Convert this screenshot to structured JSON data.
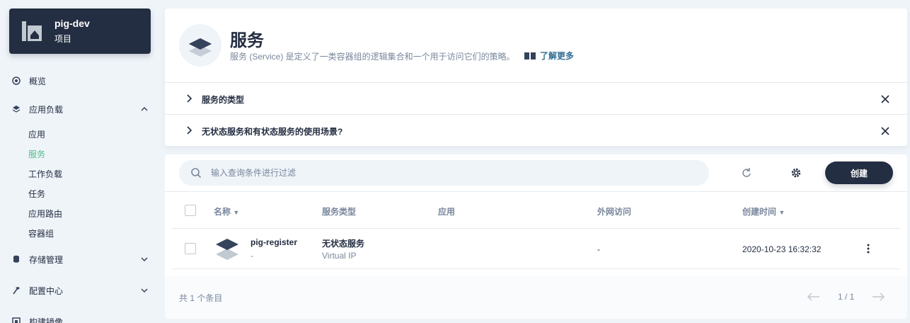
{
  "project": {
    "name": "pig-dev",
    "type": "项目"
  },
  "nav": {
    "overview": "概览",
    "workloads": "应用负载",
    "sub": [
      "应用",
      "服务",
      "工作负载",
      "任务",
      "应用路由",
      "容器组"
    ],
    "storage": "存储管理",
    "config": "配置中心",
    "build": "构建镜像"
  },
  "header": {
    "title": "服务",
    "description": "服务 (Service) 是定义了一类容器组的逻辑集合和一个用于访问它们的策略。",
    "learn_more": "了解更多",
    "collapse_1": "服务的类型",
    "collapse_2": "无状态服务和有状态服务的使用场景?"
  },
  "toolbar": {
    "search_placeholder": "输入查询条件进行过滤",
    "create_label": "创建"
  },
  "table": {
    "columns": [
      "名称",
      "服务类型",
      "应用",
      "外网访问",
      "创建时间"
    ],
    "rows": [
      {
        "name": "pig-register",
        "name_sub": "-",
        "type": "无状态服务",
        "type_sub": "Virtual IP",
        "app": "",
        "external": "-",
        "created": "2020-10-23 16:32:32"
      }
    ]
  },
  "footer": {
    "total": "共 1 个条目",
    "pagination": "1 / 1"
  },
  "colors": {
    "accent": "#55bc8a",
    "dark": "#242e42",
    "muted": "#79879c"
  }
}
